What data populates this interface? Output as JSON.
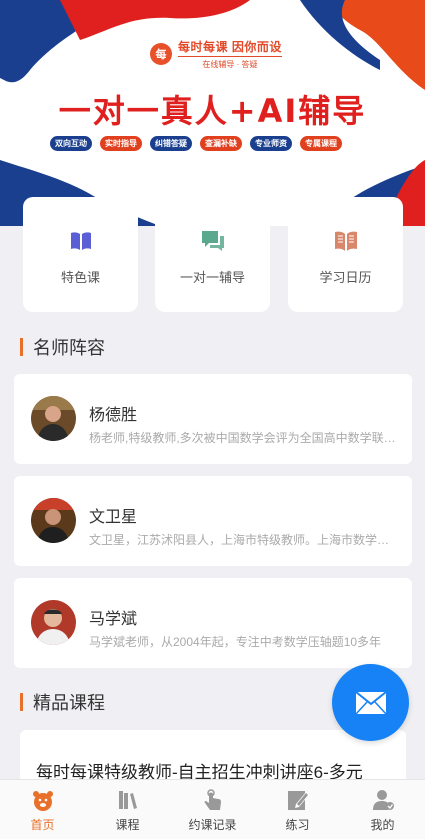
{
  "banner": {
    "brand_logo_text": "每",
    "brand_name": "每时每课  因你而设",
    "brand_sub": "在线辅导 · 答疑",
    "headline": "一对一真人+AI辅导",
    "tags": [
      {
        "label": "双向互动",
        "color": "#1b3f8f"
      },
      {
        "label": "实时指导",
        "color": "#e0401e"
      },
      {
        "label": "纠错答疑",
        "color": "#1b3f8f"
      },
      {
        "label": "查漏补缺",
        "color": "#e0401e"
      },
      {
        "label": "专业师资",
        "color": "#1b3f8f"
      },
      {
        "label": "专属课程",
        "color": "#e0401e"
      }
    ]
  },
  "quick_entries": [
    {
      "label": "特色课",
      "icon": "book-icon",
      "color": "#5b5fd6"
    },
    {
      "label": "一对一辅导",
      "icon": "chat-icon",
      "color": "#5aa88e"
    },
    {
      "label": "学习日历",
      "icon": "open-book-icon",
      "color": "#d9876a"
    }
  ],
  "sections": {
    "teachers_title": "名师阵容",
    "courses_title": "精品课程"
  },
  "teachers": [
    {
      "name": "杨德胜",
      "desc": "   杨老师,特级教师,多次被中国数学会评为全国高中数学联赛优秀教练员"
    },
    {
      "name": "文卫星",
      "desc": "文卫星，江苏沭阳县人，上海市特级教师。上海市数学学会会员"
    },
    {
      "name": "马学斌",
      "desc": "马学斌老师，从2004年起，专注中考数学压轴题10多年"
    }
  ],
  "course": {
    "title": "每时每课特级教师-自主招生冲刺讲座6-多元"
  },
  "fab": {
    "icon": "mail-icon"
  },
  "tabs": [
    {
      "label": "首页",
      "icon": "home-icon",
      "active": true
    },
    {
      "label": "课程",
      "icon": "books-icon",
      "active": false
    },
    {
      "label": "约课记录",
      "icon": "tap-icon",
      "active": false
    },
    {
      "label": "练习",
      "icon": "edit-icon",
      "active": false
    },
    {
      "label": "我的",
      "icon": "user-icon",
      "active": false
    }
  ],
  "colors": {
    "accent": "#e8702a",
    "fab": "#1682f5",
    "banner_blue": "#1b3f8f",
    "banner_red": "#e0201e"
  }
}
